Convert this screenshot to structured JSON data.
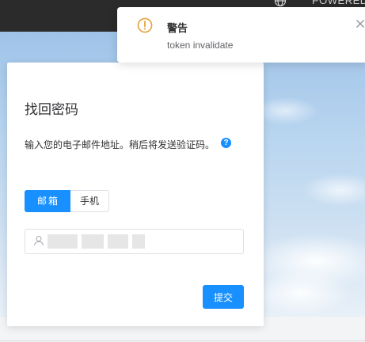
{
  "topbar": {
    "powered_text": "POWERED",
    "globe_icon": "globe-icon"
  },
  "card": {
    "title": "找回密码",
    "description": "输入您的电子邮件地址。稍后将发送验证码。",
    "help_icon": "question-circle-icon",
    "tabs": [
      {
        "label": "邮箱",
        "active": true
      },
      {
        "label": "手机",
        "active": false
      }
    ],
    "input": {
      "icon": "user-icon",
      "value": ""
    },
    "submit_label": "提交"
  },
  "notification": {
    "type": "warning",
    "icon": "warning-circle-icon",
    "title": "警告",
    "message": "token invalidate",
    "close_icon": "close-icon"
  },
  "colors": {
    "primary": "#1890ff",
    "warning": "#e6a23c",
    "topbar": "#2b2b2b",
    "text": "#303133"
  }
}
